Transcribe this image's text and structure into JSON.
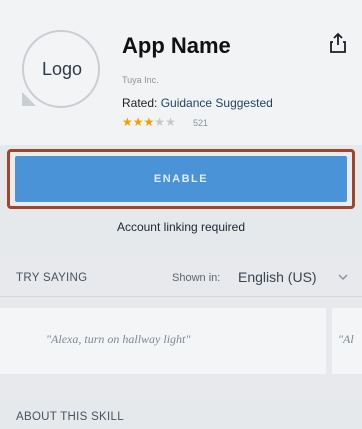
{
  "app": {
    "logo_text": "Logo",
    "name": "App Name",
    "developer": "Tuya Inc.",
    "rated_label": "Rated:",
    "rated_value": "Guidance Suggested",
    "rating": {
      "stars_filled": 3,
      "stars_total": 5,
      "review_count": "521"
    }
  },
  "actions": {
    "enable_label": "ENABLE",
    "account_linking": "Account linking required"
  },
  "try_saying": {
    "title": "TRY SAYING",
    "shown_in_label": "Shown in:",
    "language": "English (US)",
    "phrases": [
      "\"Alexa, turn on hallway light\"",
      "\"Al"
    ]
  },
  "about": {
    "title": "ABOUT THIS SKILL"
  },
  "colors": {
    "accent": "#4a93d6",
    "star": "#f0a100",
    "highlight_border": "#a0442d"
  },
  "icons": {
    "share": "share-icon",
    "chevron": "chevron-down-icon"
  }
}
